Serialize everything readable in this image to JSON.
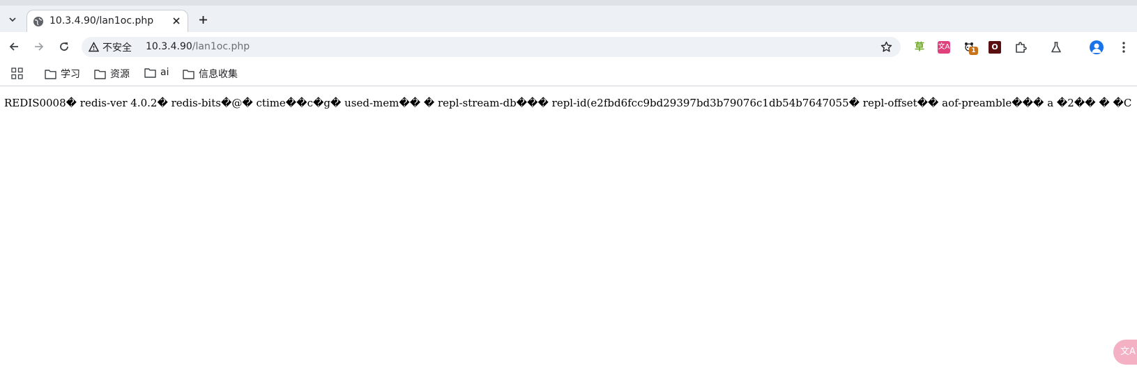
{
  "tab": {
    "title": "10.3.4.90/lan1oc.php"
  },
  "omnibox": {
    "security_label": "不安全",
    "url_host": "10.3.4.90",
    "url_path": "/lan1oc.php"
  },
  "extensions": {
    "grass_glyph": "草",
    "translate_glyph": "文A",
    "panda_badge": "1",
    "o_glyph": "O"
  },
  "bookmarks": [
    {
      "label": "学习"
    },
    {
      "label": "资源"
    },
    {
      "label": "ai"
    },
    {
      "label": "信息收集"
    }
  ],
  "page_text": "REDIS0008� redis-ver   4.0.2� redis-bits�@�   ctime��c�g�   used-mem��      �   repl-stream-db���   repl-id(e2fbd6fcc9bd29397bd3b79076c1db54b7647055�   repl-offset��   aof-preamble���      a   �2��    �    �C",
  "floating_button": {
    "glyph": "文A"
  },
  "colors": {
    "tabbar_bg": "#edf0f4",
    "omnibox_bg": "#eef1f6",
    "accent": "#1a73e8"
  }
}
